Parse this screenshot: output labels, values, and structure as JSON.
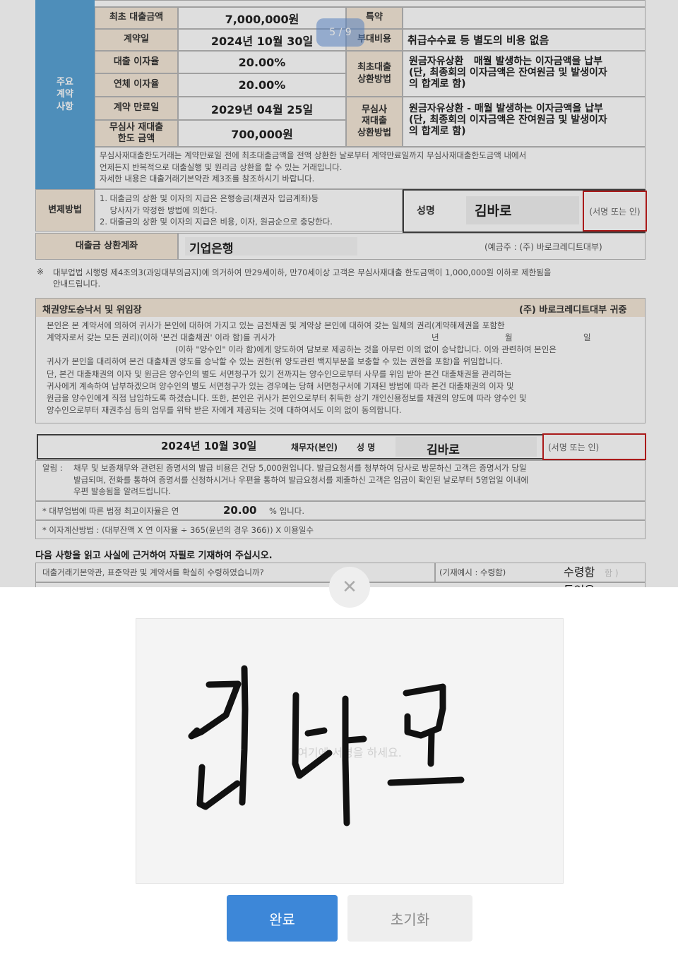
{
  "contract": {
    "side_label": "주요\n계약\n사항",
    "rows": [
      {
        "label": "최초 대출금액",
        "value": "7,000,000원"
      },
      {
        "label": "계약일",
        "value": "2024년 10월 30일"
      },
      {
        "label": "대출 이자율",
        "value": "20.00%"
      },
      {
        "label": "연체 이자율",
        "value": "20.00%"
      },
      {
        "label": "계약 만료일",
        "value": "2029년 04월 25일"
      },
      {
        "label": "무심사 재대출\n한도 금액",
        "value": "700,000원"
      }
    ],
    "right_rows": [
      {
        "label": "특약",
        "value": ""
      },
      {
        "label": "부대비용",
        "value": "취급수수료 등 별도의 비용 없음"
      },
      {
        "label": "최초대출\n상환방법",
        "value": "원금자유상환   매월 발생하는 이자금액을 납부\n(단, 최종회의 이자금액은 잔여원금 및 발생이자\n의 합계로 함)"
      },
      {
        "label": "무심사\n재대출\n상환방법",
        "value": "원금자유상환 - 매월 발생하는 이자금액을 납부\n(단, 최종회의 이자금액은 잔여원금 및 발생이자\n의 합계로 함)"
      }
    ],
    "note": "무심사재대출한도거래는 계약만료일 전에 최초대출금액을 전액 상환한 날로부터 계약만료일까지 무심사재대출한도금액 내에서\n언제든지 반복적으로 대출실행 및 원리금 상환을 할 수 있는 거래입니다.\n자세한 내용은 대출거래기본약관 제3조를 참조하시기 바랍니다."
  },
  "page_indicator": "5 / 9",
  "repayment": {
    "label": "변제방법",
    "text": "1. 대출금의 상환 및 이자의 지급은 은행송금(채권자 입금계좌)등\n    당사자가 약정한 방법에 의한다.\n2. 대출금의 상환 및 이자의 지급은 비용, 이자, 원금순으로 충당한다.",
    "name_label": "성명",
    "name_value": "김바로",
    "sign_hint": "(서명 또는 인)"
  },
  "account": {
    "label": "대출금 상환계좌",
    "bank": "기업은행",
    "holder": "(예금주 : (주) 바로크레디트대부)"
  },
  "notice_mark": "※",
  "notice": "대부업법 시행령 제4조의3(과잉대부의금지)에 의거하여 만29세이하, 만70세이상 고객은 무심사재대출 한도금액이 1,000,000원 이하로 제한됨을\n안내드립니다.",
  "assignment": {
    "title": "채권양도승낙서 및 위임장",
    "addressee": "(주) 바로크레디트대부 귀중",
    "body_1": "본인은 본 계약서에 의하여 귀사가 본인에 대하여 가지고 있는 금전채권 및 계약상 본인에 대하여 갖는 일체의 권리(계약해제권을 포함한\n계약자로서 갖는 모든 권리)(이하 '본건 대출채권' 이라 함)를 귀사가",
    "year_label": "년",
    "month_label": "월",
    "day_label": "일",
    "body_2": "(이하 \"양수인\" 이라 함)에게 양도하여 담보로 제공하는 것을 아무런 이의 없이 승낙합니다. 이와 관련하여 본인은\n귀사가 본인을 대리하여 본건 대출채권 양도를 승낙할 수 있는 권한(위 양도관련 백지부분을 보충할 수 있는 권한을 포함)을 위임합니다.\n단, 본건 대출채권의 이자 및 원금은 양수인의 별도 서면청구가 있기 전까지는 양수인으로부터 사무를 위임 받아 본건 대출채권을 관리하는\n귀사에게 계속하여 납부하겠으며 양수인의 별도 서면청구가 있는 경우에는 당해 서면청구서에 기재된 방법에 따라 본건 대출채권의 이자 및\n원금을 양수인에게 직접 납입하도록 하겠습니다. 또한, 본인은 귀사가 본인으로부터 취득한 상기 개인신용정보를 채권의 양도에 따라 양수인 및\n양수인으로부터 재권추심 등의 업무를 위탁 받은 자에게 제공되는 것에 대하여서도 이의 없이 동의합니다."
  },
  "debtor": {
    "date": "2024년 10월 30일",
    "label": "채무자(본인)",
    "name_label": "성 명",
    "name_value": "김바로",
    "sign_hint": "(서명 또는 인)"
  },
  "alert": {
    "label": "알림 :",
    "text": "채무 및 보증채무와 관련된 증명서의 발급 비용은 건당 5,000원입니다. 발급요청서를 청부하여 당사로 방문하신 고객은 증명서가 당일\n발급되며, 전화를 통하여 증명서를 신청하시거나 우편을 통하여 발급요청서를 제출하신 고객은 입금이 확인된 날로부터 5영업일 이내에\n우편 발송됨을 알려드립니다."
  },
  "max_rate": {
    "prefix": "* 대부업법에 따른 법정 최고이자율은 연",
    "value": "20.00",
    "suffix": "% 입니다."
  },
  "interest_calc": "* 이자계산방법 : (대부잔액 X 연 이자율 ÷ 365(윤년의 경우 366)) X 이용일수",
  "confirm": {
    "heading": "다음 사항을 읽고 사실에 근거하여 자필로 기재하여 주십시오.",
    "question": "대출거래기본약관, 표준약관 및 계약서를 확실히 수령하였습니까?",
    "example": "(기재예시 : 수령함)",
    "answer": "수령함",
    "answer_ghost": "함 )",
    "next_answer": "들었음"
  },
  "signature_modal": {
    "placeholder": "여기에 서명을 하세요.",
    "signed_text": "김바로",
    "done_button": "완료",
    "reset_button": "초기화"
  },
  "colors": {
    "side_blue": "#5aa4d6",
    "header_beige": "#f5e9d8",
    "sign_red": "#c41e1e",
    "button_blue": "#3d87d8"
  },
  "icons": {
    "close": "close-icon"
  }
}
